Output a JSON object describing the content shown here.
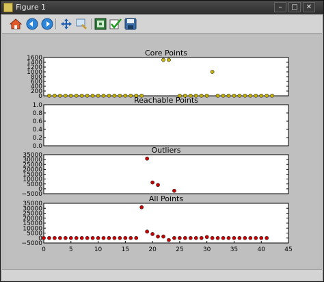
{
  "window": {
    "title": "Figure 1"
  },
  "toolbar": {
    "icons": [
      "home-icon",
      "back-arrow-icon",
      "forward-arrow-icon",
      "pan-icon",
      "zoom-icon",
      "configure-subplots-icon",
      "edit-checkmark-icon",
      "save-icon"
    ]
  },
  "colors": {
    "core": "#c8b400",
    "outlier": "#cc0000",
    "all": "#cc0000",
    "figure_bg": "#bfbfbf"
  },
  "chart_data": [
    {
      "type": "scatter",
      "title": "Core Points",
      "xlim": [
        -1,
        44
      ],
      "ylim": [
        0,
        1600
      ],
      "yticks": [
        0,
        200,
        400,
        600,
        800,
        1000,
        1200,
        1400,
        1600
      ],
      "ytick_labels": [
        "0",
        "200",
        "400",
        "600",
        "800",
        "1000",
        "1200",
        "1400",
        "1600"
      ],
      "points": [
        [
          0,
          5
        ],
        [
          1,
          5
        ],
        [
          2,
          5
        ],
        [
          3,
          5
        ],
        [
          4,
          5
        ],
        [
          5,
          5
        ],
        [
          6,
          5
        ],
        [
          7,
          5
        ],
        [
          8,
          5
        ],
        [
          9,
          5
        ],
        [
          10,
          5
        ],
        [
          11,
          5
        ],
        [
          12,
          5
        ],
        [
          13,
          5
        ],
        [
          14,
          5
        ],
        [
          15,
          5
        ],
        [
          16,
          5
        ],
        [
          17,
          5
        ],
        [
          21,
          1500
        ],
        [
          22,
          1500
        ],
        [
          24,
          5
        ],
        [
          25,
          5
        ],
        [
          26,
          5
        ],
        [
          27,
          5
        ],
        [
          28,
          5
        ],
        [
          29,
          5
        ],
        [
          30,
          1000
        ],
        [
          31,
          5
        ],
        [
          32,
          5
        ],
        [
          33,
          5
        ],
        [
          34,
          5
        ],
        [
          35,
          5
        ],
        [
          36,
          5
        ],
        [
          37,
          5
        ],
        [
          38,
          5
        ],
        [
          39,
          5
        ],
        [
          40,
          5
        ],
        [
          41,
          5
        ]
      ],
      "color": "#c8b400"
    },
    {
      "type": "scatter",
      "title": "Reachable Points",
      "xlim": [
        -1,
        44
      ],
      "ylim": [
        0,
        1.0
      ],
      "yticks": [
        0,
        0.2,
        0.4,
        0.6,
        0.8,
        1.0
      ],
      "ytick_labels": [
        "0.0",
        "0.2",
        "0.4",
        "0.6",
        "0.8",
        "1.0"
      ],
      "points": [],
      "color": "#c8b400"
    },
    {
      "type": "scatter",
      "title": "Outliers",
      "xlim": [
        -1,
        44
      ],
      "ylim": [
        -5000,
        35000
      ],
      "yticks": [
        -5000,
        0,
        5000,
        10000,
        15000,
        20000,
        25000,
        30000,
        35000
      ],
      "ytick_labels": [
        "−5000",
        "0",
        "5000",
        "10000",
        "15000",
        "20000",
        "25000",
        "30000",
        "35000"
      ],
      "points": [
        [
          18,
          31000
        ],
        [
          19,
          6500
        ],
        [
          20,
          4000
        ],
        [
          23,
          -2000
        ]
      ],
      "color": "#cc0000"
    },
    {
      "type": "scatter",
      "title": "All Points",
      "xlim": [
        0,
        45
      ],
      "ylim": [
        -5000,
        35000
      ],
      "yticks": [
        -5000,
        0,
        5000,
        10000,
        15000,
        20000,
        25000,
        30000,
        35000
      ],
      "ytick_labels": [
        "−5000",
        "0",
        "5000",
        "10000",
        "15000",
        "20000",
        "25000",
        "30000",
        "35000"
      ],
      "xticks": [
        0,
        5,
        10,
        15,
        20,
        25,
        30,
        35,
        40,
        45
      ],
      "xtick_labels": [
        "0",
        "5",
        "10",
        "15",
        "20",
        "25",
        "30",
        "35",
        "40",
        "45"
      ],
      "points": [
        [
          0,
          0
        ],
        [
          1,
          0
        ],
        [
          2,
          0
        ],
        [
          3,
          0
        ],
        [
          4,
          0
        ],
        [
          5,
          0
        ],
        [
          6,
          0
        ],
        [
          7,
          0
        ],
        [
          8,
          0
        ],
        [
          9,
          0
        ],
        [
          10,
          0
        ],
        [
          11,
          0
        ],
        [
          12,
          0
        ],
        [
          13,
          0
        ],
        [
          14,
          0
        ],
        [
          15,
          0
        ],
        [
          16,
          0
        ],
        [
          17,
          0
        ],
        [
          18,
          31000
        ],
        [
          19,
          6500
        ],
        [
          20,
          4000
        ],
        [
          21,
          1500
        ],
        [
          22,
          1500
        ],
        [
          23,
          -2000
        ],
        [
          24,
          0
        ],
        [
          25,
          0
        ],
        [
          26,
          0
        ],
        [
          27,
          0
        ],
        [
          28,
          0
        ],
        [
          29,
          0
        ],
        [
          30,
          1000
        ],
        [
          31,
          0
        ],
        [
          32,
          0
        ],
        [
          33,
          0
        ],
        [
          34,
          0
        ],
        [
          35,
          0
        ],
        [
          36,
          0
        ],
        [
          37,
          0
        ],
        [
          38,
          0
        ],
        [
          39,
          0
        ],
        [
          40,
          0
        ],
        [
          41,
          0
        ]
      ],
      "color": "#cc0000"
    }
  ]
}
